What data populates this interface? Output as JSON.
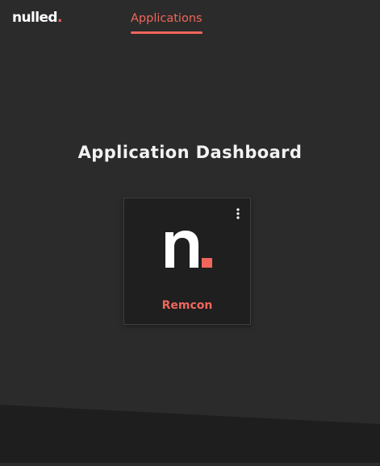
{
  "brand": {
    "name": "nulled",
    "dot": ".",
    "accent_color": "#f0665b"
  },
  "nav": {
    "tabs": [
      {
        "label": "Applications",
        "active": true
      }
    ]
  },
  "main": {
    "title": "Application Dashboard"
  },
  "apps": [
    {
      "name": "Remcon",
      "icon": "nulled-n-logo-icon",
      "menu_icon": "more-vertical-icon"
    }
  ],
  "colors": {
    "background": "#2b2b2b",
    "card_background": "#1f1f1f",
    "footer_background": "#1e1e1e",
    "accent": "#f0665b"
  }
}
